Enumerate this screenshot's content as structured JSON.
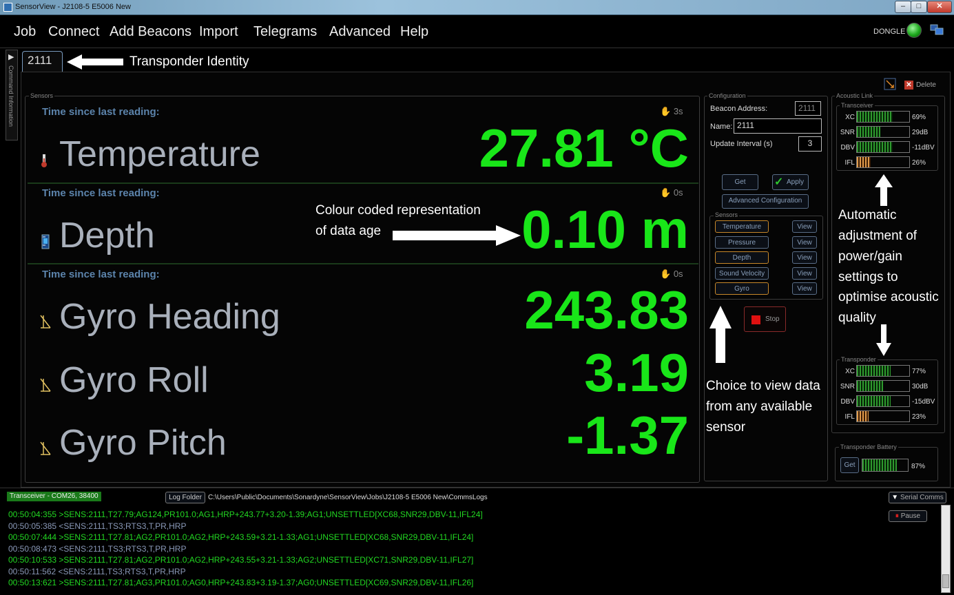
{
  "window": {
    "title": "SensorView - J2108-5 E5006 New"
  },
  "menu": [
    "Job",
    "Connect",
    "Add Beacons",
    "Import",
    "Telegrams",
    "Advanced",
    "Help"
  ],
  "status": {
    "dongle_label": "DONGLE",
    "dongle_color": "#1da81d"
  },
  "side_strip": {
    "label": "Command Information"
  },
  "tab": {
    "label": "2111"
  },
  "annotations": {
    "transponder_identity": "Transponder Identity",
    "data_age_line1": "Colour coded representation",
    "data_age_line2": "of data age",
    "acoustic_lines": [
      "Automatic",
      "adjustment of",
      "power/gain",
      "settings to",
      "optimise acoustic",
      "quality"
    ],
    "sensor_choice_lines": [
      "Choice to view data",
      "from any available",
      "sensor"
    ]
  },
  "sensors": {
    "group_label": "Sensors",
    "time_label": "Time since last reading:",
    "items": [
      {
        "name": "Temperature",
        "value": "27.81 °C",
        "age": "3s"
      },
      {
        "name": "Depth",
        "value": "0.10 m",
        "age": "0s"
      },
      {
        "name": "Gyro Heading",
        "value": "243.83",
        "age": "0s"
      },
      {
        "name": "Gyro Roll",
        "value": "3.19"
      },
      {
        "name": "Gyro Pitch",
        "value": "-1.37"
      }
    ]
  },
  "toolbar": {
    "delete_label": "Delete"
  },
  "configuration": {
    "group_label": "Configuration",
    "beacon_address_label": "Beacon Address:",
    "beacon_address": "2111",
    "name_label": "Name:",
    "name_value": "2111",
    "update_interval_label": "Update Interval (s)",
    "update_interval": "3",
    "get_label": "Get",
    "apply_label": "Apply",
    "advanced_label": "Advanced Configuration",
    "sensors_label": "Sensors",
    "sensor_buttons": [
      "Temperature",
      "Pressure",
      "Depth",
      "Sound Velocity",
      "Gyro"
    ],
    "view_label": "View",
    "stop_label": "Stop"
  },
  "acoustic_link": {
    "group_label": "Acoustic Link",
    "transceiver": {
      "label": "Transceiver",
      "rows": [
        {
          "name": "XC",
          "value": "69%",
          "level": 0.69,
          "color": "green"
        },
        {
          "name": "SNR",
          "value": "29dB",
          "level": 0.45,
          "color": "green"
        },
        {
          "name": "DBV",
          "value": "-11dBV",
          "level": 0.68,
          "color": "green"
        },
        {
          "name": "IFL",
          "value": "26%",
          "level": 0.26,
          "color": "orange"
        }
      ]
    },
    "transponder": {
      "label": "Transponder",
      "rows": [
        {
          "name": "XC",
          "value": "77%",
          "level": 0.65,
          "color": "green"
        },
        {
          "name": "SNR",
          "value": "30dB",
          "level": 0.5,
          "color": "green"
        },
        {
          "name": "DBV",
          "value": "-15dBV",
          "level": 0.64,
          "color": "green"
        },
        {
          "name": "IFL",
          "value": "23%",
          "level": 0.23,
          "color": "orange"
        }
      ]
    }
  },
  "battery": {
    "group_label": "Transponder Battery",
    "get_label": "Get",
    "value": "87%",
    "level": 0.75
  },
  "log": {
    "port_label": "Transceiver - COM26, 38400",
    "folder_button": "Log Folder",
    "folder_path": "C:\\Users\\Public\\Documents\\Sonardyne\\SensorView\\Jobs\\J2108-5 E5006 New\\CommsLogs",
    "serial_comms_label": "Serial Comms",
    "pause_label": "Pause",
    "lines": [
      {
        "text": "00:50:04:355 >SENS:2111,T27.79;AG124,PR101.0;AG1,HRP+243.77+3.20-1.39;AG1;UNSETTLED[XC68,SNR29,DBV-11,IFL24]",
        "kind": "tx"
      },
      {
        "text": "00:50:05:385 <SENS:2111,TS3;RTS3,T,PR,HRP",
        "kind": "rx"
      },
      {
        "text": "00:50:07:444 >SENS:2111,T27.81;AG2,PR101.0;AG2,HRP+243.59+3.21-1.33;AG1;UNSETTLED[XC68,SNR29,DBV-11,IFL24]",
        "kind": "tx"
      },
      {
        "text": "00:50:08:473 <SENS:2111,TS3;RTS3,T,PR,HRP",
        "kind": "rx"
      },
      {
        "text": "00:50:10:533 >SENS:2111,T27.81;AG2,PR101.0;AG2,HRP+243.55+3.21-1.33;AG2;UNSETTLED[XC71,SNR29,DBV-11,IFL27]",
        "kind": "tx"
      },
      {
        "text": "00:50:11:562 <SENS:2111,TS3;RTS3,T,PR,HRP",
        "kind": "rx"
      },
      {
        "text": "00:50:13:621 >SENS:2111,T27.81;AG3,PR101.0;AG0,HRP+243.83+3.19-1.37;AG0;UNSETTLED[XC69,SNR29,DBV-11,IFL26]",
        "kind": "tx"
      }
    ]
  }
}
